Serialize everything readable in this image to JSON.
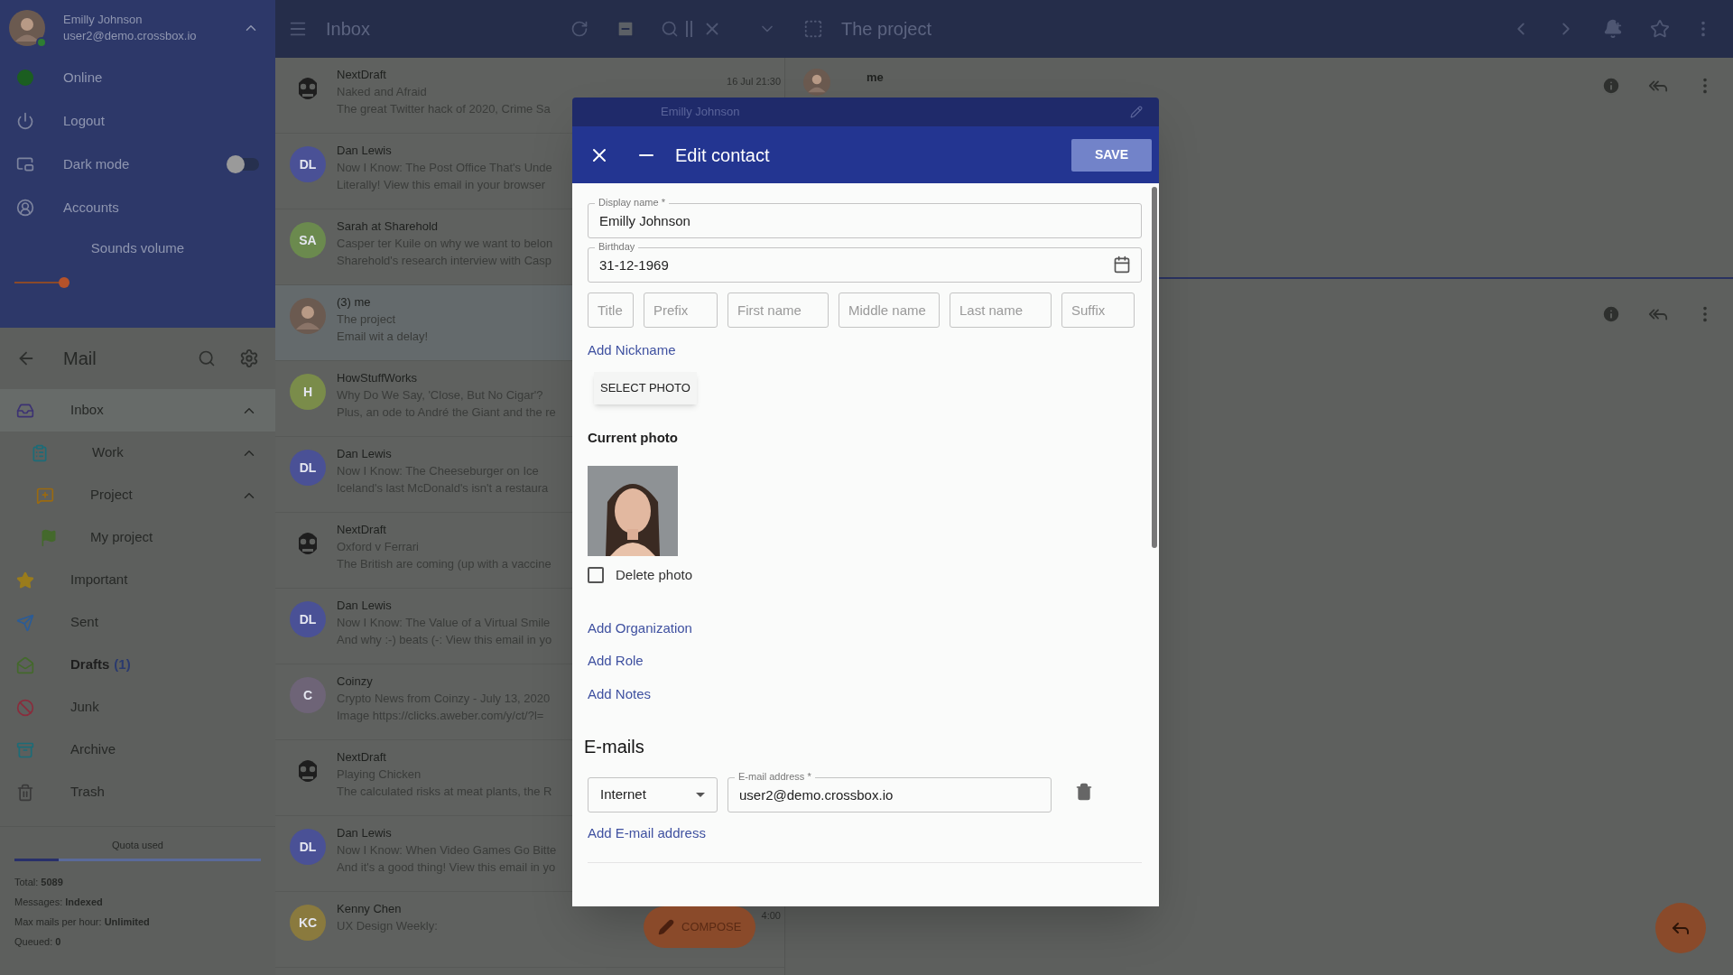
{
  "account": {
    "name": "Emilly Johnson",
    "email": "user2@demo.crossbox.io",
    "online": true
  },
  "account_menu": [
    {
      "kind": "status",
      "label": "Online"
    },
    {
      "kind": "logout",
      "label": "Logout"
    },
    {
      "kind": "toggle",
      "label": "Dark mode",
      "on": false
    },
    {
      "kind": "accounts",
      "label": "Accounts"
    }
  ],
  "sounds_volume": {
    "label": "Sounds volume",
    "level": 0.2
  },
  "mail_header": {
    "title": "Mail"
  },
  "folders": [
    {
      "kind": "inbox",
      "label": "Inbox",
      "selected": true,
      "expanded": true,
      "children": [
        {
          "kind": "clipboard",
          "label": "Work",
          "selected": false,
          "expanded": true,
          "children": [
            {
              "kind": "label",
              "label": "Project",
              "selected": false,
              "expanded": true,
              "children": [
                {
                  "kind": "flag",
                  "label": "My project",
                  "selected": false
                }
              ]
            }
          ]
        }
      ]
    },
    {
      "kind": "star",
      "label": "Important",
      "selected": false
    },
    {
      "kind": "send",
      "label": "Sent",
      "selected": false
    },
    {
      "kind": "drafts",
      "label": "Drafts",
      "count": "(1)",
      "selected": false
    },
    {
      "kind": "junk",
      "label": "Junk",
      "selected": false
    },
    {
      "kind": "archive",
      "label": "Archive",
      "selected": false
    },
    {
      "kind": "trash",
      "label": "Trash",
      "selected": false
    }
  ],
  "quota": {
    "label": "Quota used",
    "level": 0.18,
    "stats": [
      "Total: **5089**",
      "Messages: **Indexed**",
      "Max mails per hour: **Unlimited**",
      "Queued: **0**"
    ]
  },
  "list_toolbar": {
    "title": "Inbox"
  },
  "messages": [
    {
      "avatar": {
        "kind": "mascot"
      },
      "sender": "NextDraft",
      "subject": "Naked and Afraid",
      "preview": "The great Twitter hack of 2020, Crime Sa",
      "date": "16 Jul 21:30",
      "selected": false
    },
    {
      "avatar": {
        "kind": "initials",
        "initials": "DL",
        "color": "#4a5196"
      },
      "sender": "Dan Lewis",
      "subject": "Now I Know: The Post Office That's Unde",
      "preview": "Literally! View this email in your browser",
      "selected": false
    },
    {
      "avatar": {
        "kind": "initials",
        "initials": "SA",
        "color": "#6b8a4e"
      },
      "sender": "Sarah at Sharehold",
      "subject": "Casper ter Kuile on why we want to belon",
      "preview": "Sharehold's research interview with Casp",
      "selected": false
    },
    {
      "sender": "(3) me",
      "subject": "The project",
      "preview": "Email wit a delay!",
      "selected": true
    },
    {
      "avatar": {
        "kind": "initials",
        "initials": "H",
        "color": "#7a8c4a"
      },
      "sender": "HowStuffWorks",
      "subject": "Why Do We Say, 'Close, But No Cigar'?",
      "preview": "Plus, an ode to André the Giant and the re",
      "selected": false
    },
    {
      "avatar": {
        "kind": "initials",
        "initials": "DL",
        "color": "#4a5196"
      },
      "sender": "Dan Lewis",
      "subject": "Now I Know: The Cheeseburger on Ice",
      "preview": "Iceland's last McDonald's isn't a restaura",
      "selected": false
    },
    {
      "avatar": {
        "kind": "mascot"
      },
      "sender": "NextDraft",
      "subject": "Oxford v Ferrari",
      "preview": "The British are coming (up with a vaccine",
      "selected": false
    },
    {
      "avatar": {
        "kind": "initials",
        "initials": "DL",
        "color": "#4a5196"
      },
      "sender": "Dan Lewis",
      "subject": "Now I Know: The Value of a Virtual Smile",
      "preview": "And why :-) beats (-:  View this email in yo",
      "selected": false
    },
    {
      "avatar": {
        "kind": "initials",
        "initials": "C",
        "color": "#6e6477"
      },
      "sender": "Coinzy",
      "subject": "Crypto News from Coinzy - July 13, 2020",
      "preview": "Image https://clicks.aweber.com/y/ct/?l=",
      "selected": false
    },
    {
      "avatar": {
        "kind": "mascot"
      },
      "sender": "NextDraft",
      "subject": "Playing Chicken",
      "preview": "The calculated risks at meat plants, the R",
      "selected": false
    },
    {
      "avatar": {
        "kind": "initials",
        "initials": "DL",
        "color": "#4a5196"
      },
      "sender": "Dan Lewis",
      "subject": "Now I Know: When Video Games Go Bitte",
      "preview": "And it's a good thing! View this email in yo",
      "selected": false
    },
    {
      "avatar": {
        "kind": "initials",
        "initials": "KC",
        "color": "#8a7a3e"
      },
      "sender": "Kenny Chen",
      "subject": "UX Design Weekly:",
      "date": "4:00",
      "selected": false
    }
  ],
  "compose": {
    "label": "COMPOSE"
  },
  "reading_pane": {
    "title": "The project",
    "messages": [
      {
        "sender": "me"
      }
    ]
  },
  "back_dialog": {
    "title": "Emilly Johnson"
  },
  "dialog": {
    "title": "Edit contact",
    "save": "SAVE",
    "display_name": {
      "label": "Display name *",
      "value": "Emilly Johnson"
    },
    "birthday": {
      "label": "Birthday",
      "value": "31-12-1969"
    },
    "name_parts": [
      {
        "placeholder": "Title"
      },
      {
        "placeholder": "Prefix"
      },
      {
        "placeholder": "First name"
      },
      {
        "placeholder": "Middle name"
      },
      {
        "placeholder": "Last name"
      },
      {
        "placeholder": "Suffix"
      }
    ],
    "add_nickname": "Add Nickname",
    "select_photo": "SELECT PHOTO",
    "current_photo": "Current photo",
    "delete_photo": {
      "label": "Delete photo",
      "checked": false
    },
    "links": [
      "Add Organization",
      "Add Role",
      "Add Notes"
    ],
    "emails_heading": "E-mails",
    "emails": [
      {
        "type": "Internet",
        "label": "E-mail address *",
        "value": "user2@demo.crossbox.io"
      }
    ],
    "add_email": "Add E-mail address"
  }
}
